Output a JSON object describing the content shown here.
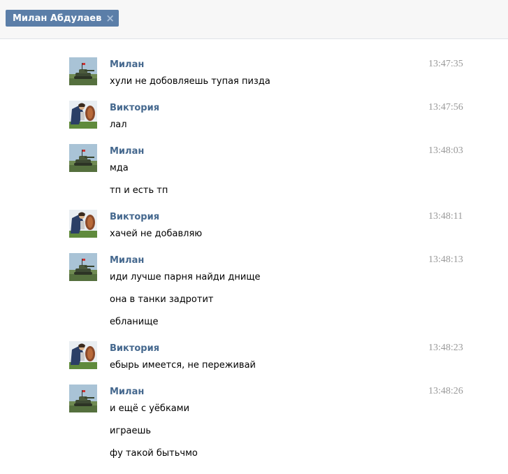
{
  "chat_tab": {
    "label": "Милан Абдулаев",
    "close_icon": "×"
  },
  "messages": [
    {
      "author": "Милан",
      "avatar": "tank-avatar",
      "time": "13:47:35",
      "lines": [
        "хули не добовляешь тупая пизда"
      ]
    },
    {
      "author": "Виктория",
      "avatar": "warrior-avatar",
      "time": "13:47:56",
      "lines": [
        "лал"
      ]
    },
    {
      "author": "Милан",
      "avatar": "tank-avatar",
      "time": "13:48:03",
      "lines": [
        "мда",
        "тп и есть тп"
      ]
    },
    {
      "author": "Виктория",
      "avatar": "warrior-avatar",
      "time": "13:48:11",
      "lines": [
        "хачей не добавляю"
      ]
    },
    {
      "author": "Милан",
      "avatar": "tank-avatar",
      "time": "13:48:13",
      "lines": [
        "иди лучше парня найди днище",
        "она в танки задротит",
        "ебланище"
      ]
    },
    {
      "author": "Виктория",
      "avatar": "warrior-avatar",
      "time": "13:48:23",
      "lines": [
        "ебырь имеется, не переживай"
      ]
    },
    {
      "author": "Милан",
      "avatar": "tank-avatar",
      "time": "13:48:26",
      "lines": [
        "и ещё с уёбками",
        "играешь",
        "фу такой бытьчмо"
      ]
    }
  ]
}
